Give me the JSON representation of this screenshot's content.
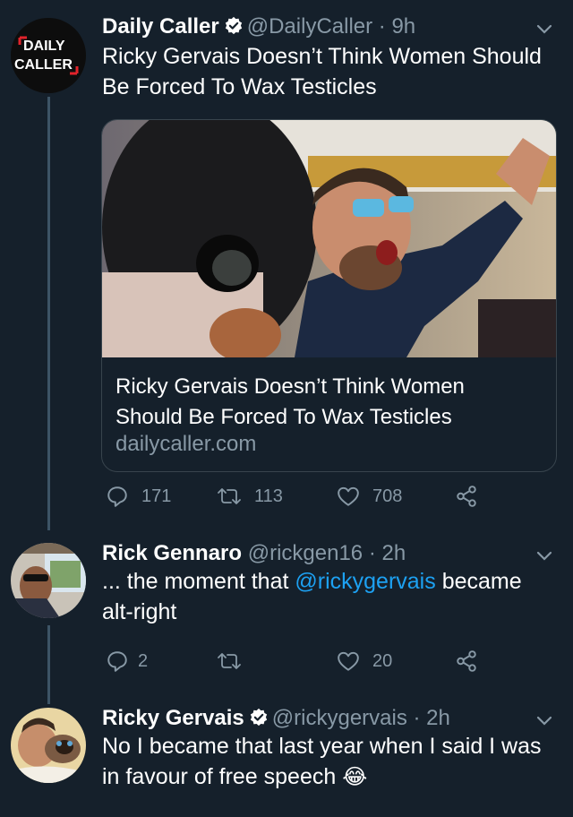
{
  "tweets": [
    {
      "name": "Daily Caller",
      "handle": "@DailyCaller",
      "time": "· 9h",
      "verified": true,
      "text": "Ricky Gervais Doesn’t Think Women Should Be Forced To Wax Testicles",
      "avatar_text": [
        "DAILY",
        "CALLER"
      ],
      "card": {
        "title": "Ricky Gervais Doesn’t Think Women Should Be Forced To Wax Testicles",
        "domain": "dailycaller.com"
      },
      "replies": "171",
      "retweets": "113",
      "likes": "708"
    },
    {
      "name": "Rick Gennaro",
      "handle": "@rickgen16",
      "time": "· 2h",
      "verified": false,
      "text_before": "... the moment that ",
      "mention": "@rickygervais",
      "text_after": " became alt-right",
      "replies": "2",
      "retweets": "",
      "likes": "20"
    },
    {
      "name": "Ricky Gervais",
      "handle": "@rickygervais",
      "time": "· 2h",
      "verified": true,
      "text": "No I became that last year when I said I was in favour of free speech",
      "emoji": "😂"
    }
  ],
  "colors": {
    "background": "#15202b",
    "secondary_text": "#8899a6",
    "link": "#1da1f2",
    "verified": "#ffffff",
    "thread_line": "#3d5466"
  }
}
